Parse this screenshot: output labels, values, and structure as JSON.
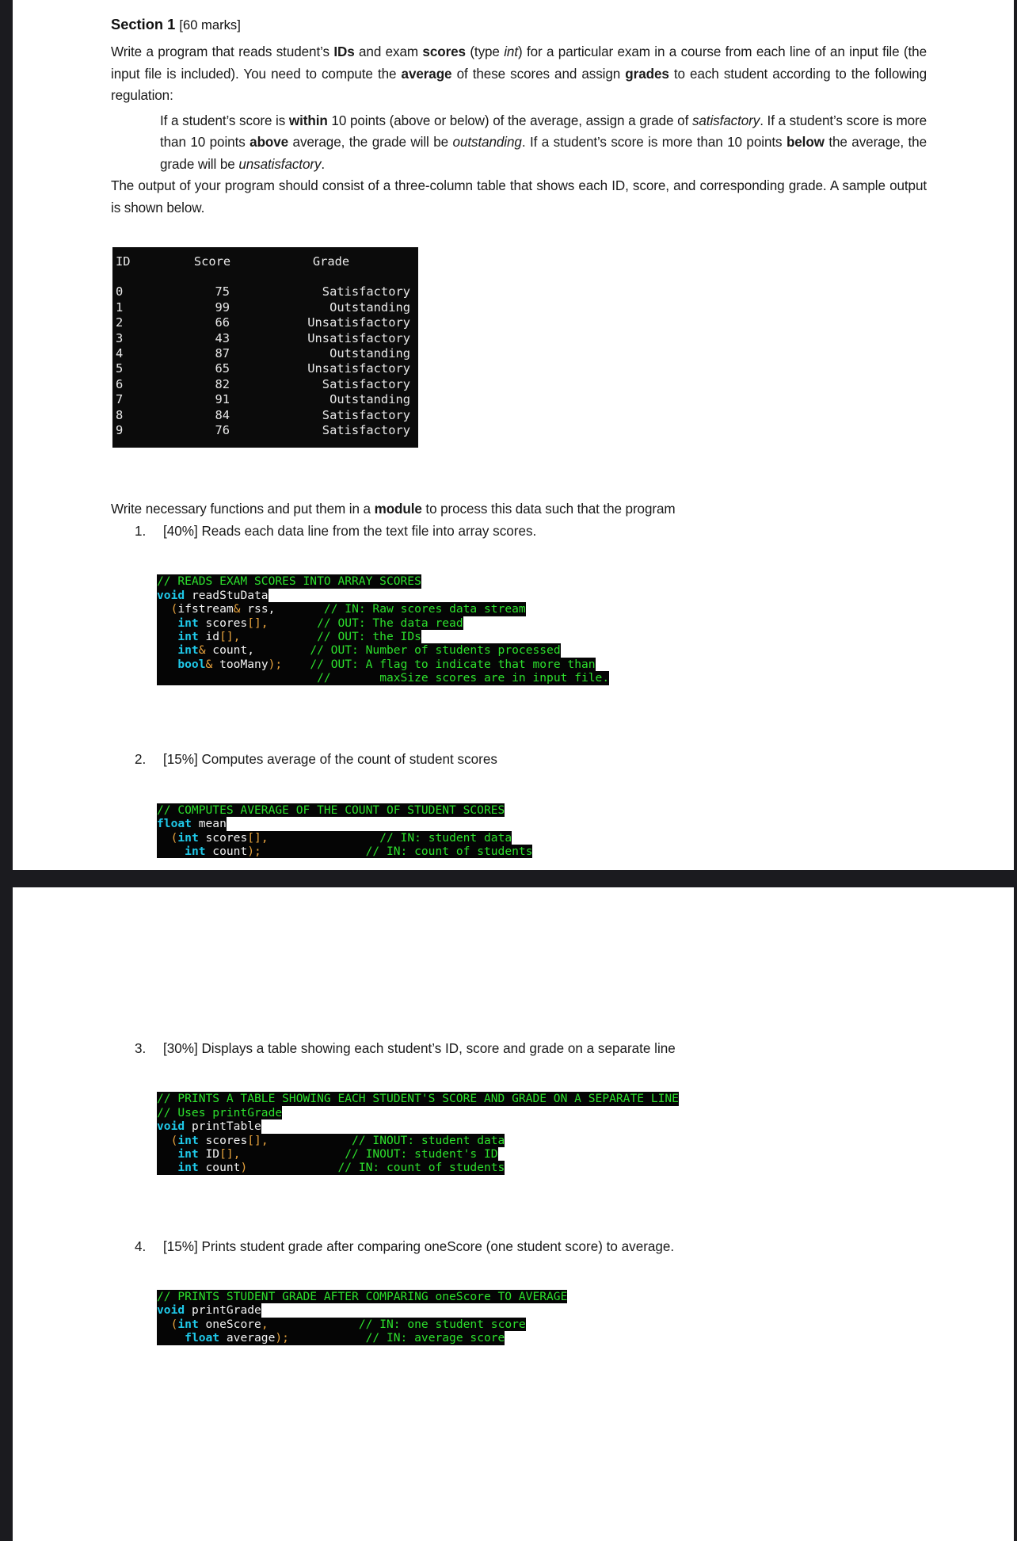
{
  "document": {
    "section": {
      "title": "Section 1",
      "marks": "[60 marks]"
    },
    "intro_paragraph": {
      "part1": "Write a program that reads student’s ",
      "bold1": "IDs",
      "part2": " and exam ",
      "bold2": "scores",
      "part3": " (type ",
      "italic1": "int",
      "part4": ") for a particular exam in a course from each line of an input file (the input file is included). You need to compute the ",
      "bold3": "average",
      "part5": " of these scores and assign ",
      "bold4": "grades",
      "part6": " to each student according to the following regulation:"
    },
    "regulation_paragraph": {
      "part1": "If a student’s score is ",
      "bold1": "within",
      "part2": " 10 points (above or below) of the average, assign a grade of ",
      "italic1": "satisfactory",
      "part3": ". If a student’s score is more than 10 points ",
      "bold2": "above",
      "part4": " average, the grade will be ",
      "italic2": "outstanding",
      "part5": ". If a student’s score is more than 10 points ",
      "bold3": "below",
      "part6": " the average, the grade will be ",
      "italic3": "unsatisfactory",
      "part7": "."
    },
    "output_paragraph": "The output of your program should consist of a three-column table that shows each ID, score, and corresponding grade. A sample output is shown below.",
    "module_paragraph": {
      "part1": "Write necessary functions and put them in a ",
      "bold1": "module",
      "part2": " to process this data such that the program"
    }
  },
  "console_table": {
    "headers": {
      "id": "ID",
      "score": "Score",
      "grade": "Grade"
    },
    "rows": [
      {
        "id": "0",
        "score": "75",
        "grade": "Satisfactory"
      },
      {
        "id": "1",
        "score": "99",
        "grade": "Outstanding"
      },
      {
        "id": "2",
        "score": "66",
        "grade": "Unsatisfactory"
      },
      {
        "id": "3",
        "score": "43",
        "grade": "Unsatisfactory"
      },
      {
        "id": "4",
        "score": "87",
        "grade": "Outstanding"
      },
      {
        "id": "5",
        "score": "65",
        "grade": "Unsatisfactory"
      },
      {
        "id": "6",
        "score": "82",
        "grade": "Satisfactory"
      },
      {
        "id": "7",
        "score": "91",
        "grade": "Outstanding"
      },
      {
        "id": "8",
        "score": "84",
        "grade": "Satisfactory"
      },
      {
        "id": "9",
        "score": "76",
        "grade": "Satisfactory"
      }
    ]
  },
  "tasks": [
    {
      "num": "1.",
      "text": "[40%] Reads each data line from the text file into array scores."
    },
    {
      "num": "2.",
      "text": "[15%] Computes average of the count of student scores"
    },
    {
      "num": "3.",
      "text": "[30%] Displays a table showing each student’s ID, score and grade on a separate line"
    },
    {
      "num": "4.",
      "text": "[15%] Prints student grade after comparing oneScore (one student score) to average."
    }
  ],
  "code_blocks": {
    "read_stu_data": {
      "l1_comment": "// READS EXAM SCORES INTO ARRAY SCORES",
      "l2_kw": "void",
      "l2_name": " readStuData",
      "l3_pun_open": "(",
      "l3_type": "ifstream",
      "l3_amp": "&",
      "l3_name": " rss,",
      "l3_comment": "// IN: Raw scores data stream",
      "l4_kw": "int",
      "l4_name": " scores",
      "l4_pun": "[],",
      "l4_comment": "// OUT: The data read",
      "l5_kw": "int",
      "l5_name": " id",
      "l5_pun": "[],",
      "l5_comment": "// OUT: the IDs",
      "l6_kw": "int",
      "l6_amp": "&",
      "l6_name": " count,",
      "l6_comment": "// OUT: Number of students processed",
      "l7_kw": "bool",
      "l7_amp": "&",
      "l7_name": " tooMany",
      "l7_pun": ");",
      "l7_comment": "// OUT: A flag to indicate that more than",
      "l8_comment_a": "//",
      "l8_comment_b": "maxSize scores are in input file."
    },
    "mean": {
      "l1_comment": "// COMPUTES AVERAGE OF THE COUNT OF STUDENT SCORES",
      "l2_kw": "float",
      "l2_name": " mean",
      "l3_pun_open": "(",
      "l3_kw": "int",
      "l3_name": " scores",
      "l3_pun": "[],",
      "l3_comment": "// IN: student data",
      "l4_kw": "int",
      "l4_name": " count",
      "l4_pun": ");",
      "l4_comment": "// IN: count of students"
    },
    "print_table": {
      "l1_comment": "// PRINTS A TABLE SHOWING EACH STUDENT'S SCORE AND GRADE ON A SEPARATE LINE",
      "l2_comment": "// Uses printGrade",
      "l3_kw": "void",
      "l3_name": " printTable",
      "l4_pun_open": "(",
      "l4_kw": "int",
      "l4_name": " scores",
      "l4_pun": "[],",
      "l4_comment": "// INOUT: student data",
      "l5_kw": "int",
      "l5_name": " ID",
      "l5_pun": "[],",
      "l5_comment": "// INOUT: student's ID",
      "l6_kw": "int",
      "l6_name": " count",
      "l6_pun": ")",
      "l6_comment": "// IN: count of students"
    },
    "print_grade": {
      "l1_comment": "// PRINTS STUDENT GRADE AFTER COMPARING oneScore TO AVERAGE",
      "l2_kw": "void",
      "l2_name": " printGrade",
      "l3_pun_open": "(",
      "l3_kw": "int",
      "l3_name": " oneScore",
      "l3_pun": ",",
      "l3_comment": "// IN: one student score",
      "l4_kw": "float",
      "l4_name": " average",
      "l4_pun": ");",
      "l4_comment": "// IN: average score"
    }
  }
}
